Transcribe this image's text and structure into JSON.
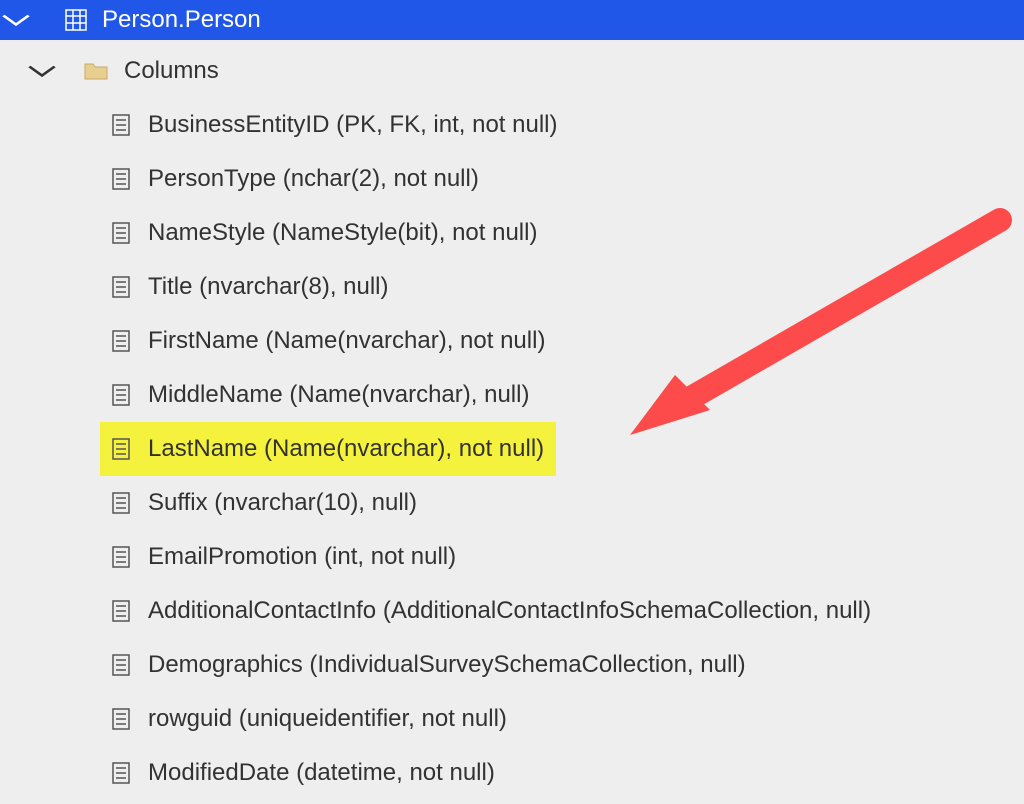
{
  "header": {
    "title": "Person.Person"
  },
  "columns_label": "Columns",
  "columns": [
    {
      "label": "BusinessEntityID (PK, FK, int, not null)",
      "highlighted": false
    },
    {
      "label": "PersonType (nchar(2), not null)",
      "highlighted": false
    },
    {
      "label": "NameStyle (NameStyle(bit), not null)",
      "highlighted": false
    },
    {
      "label": "Title (nvarchar(8), null)",
      "highlighted": false
    },
    {
      "label": "FirstName (Name(nvarchar), not null)",
      "highlighted": false
    },
    {
      "label": "MiddleName (Name(nvarchar), null)",
      "highlighted": false
    },
    {
      "label": "LastName (Name(nvarchar), not null)",
      "highlighted": true
    },
    {
      "label": "Suffix (nvarchar(10), null)",
      "highlighted": false
    },
    {
      "label": "EmailPromotion (int, not null)",
      "highlighted": false
    },
    {
      "label": "AdditionalContactInfo (AdditionalContactInfoSchemaCollection, null)",
      "highlighted": false
    },
    {
      "label": "Demographics (IndividualSurveySchemaCollection, null)",
      "highlighted": false
    },
    {
      "label": "rowguid (uniqueidentifier, not null)",
      "highlighted": false
    },
    {
      "label": "ModifiedDate (datetime, not null)",
      "highlighted": false
    }
  ]
}
